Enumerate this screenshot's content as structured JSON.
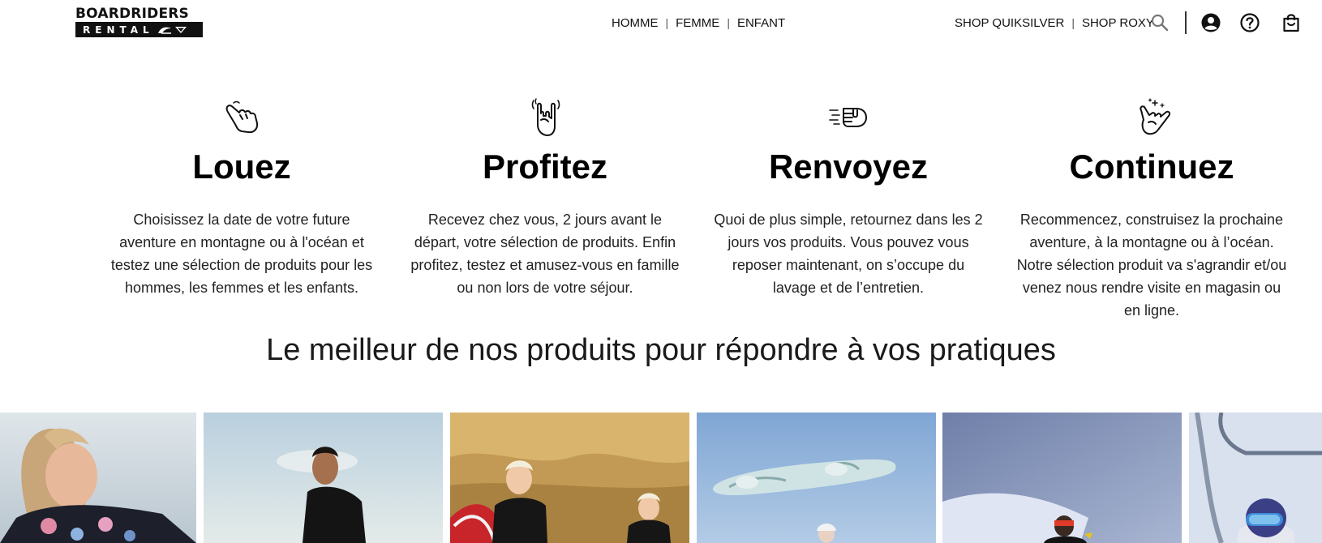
{
  "header": {
    "logo_top": "BOARDRIDERS",
    "logo_bottom": "RENTAL",
    "nav_center": [
      {
        "label": "HOMME"
      },
      {
        "label": "FEMME"
      },
      {
        "label": "ENFANT"
      }
    ],
    "nav_right": [
      {
        "label": "SHOP QUIKSILVER"
      },
      {
        "label": "SHOP ROXY"
      }
    ],
    "icons": [
      "search-icon",
      "account-icon",
      "help-icon",
      "cart-icon"
    ]
  },
  "steps": [
    {
      "icon": "pointing-hand-icon",
      "title": "Louez",
      "text": "Choisissez la date de votre future aventure en montagne ou à l'océan et testez une sélection de produits pour les hommes, les femmes et les enfants."
    },
    {
      "icon": "rock-hand-icon",
      "title": "Profitez",
      "text": "Recevez chez vous, 2 jours avant le départ, votre sélection de produits. Enfin profitez, testez et amusez-vous en famille ou non lors de votre séjour."
    },
    {
      "icon": "sending-hand-icon",
      "title": "Renvoyez",
      "text": "Quoi de plus simple, retournez dans les 2 jours vos produits. Vous pouvez vous reposer maintenant, on s’occupe du lavage et de l’entretien."
    },
    {
      "icon": "shaka-hand-icon",
      "title": "Continuez",
      "text": "Recommencez, construisez la prochaine aventure, à la montagne ou à l’océan. Notre sélection produit va s'agrandir et/ou venez nous rendre visite en magasin ou en ligne."
    }
  ],
  "section_heading": "Le meilleur de nos produits pour répondre à vos pratiques",
  "products": [
    {
      "name": "roxy-surfer-woman"
    },
    {
      "name": "surfer-man-wetsuit"
    },
    {
      "name": "kids-surf-cliff"
    },
    {
      "name": "snowboard-sky"
    },
    {
      "name": "snowboarder-powder"
    },
    {
      "name": "skier-chairlift"
    }
  ],
  "colors": {
    "text": "#111111",
    "background": "#ffffff"
  }
}
